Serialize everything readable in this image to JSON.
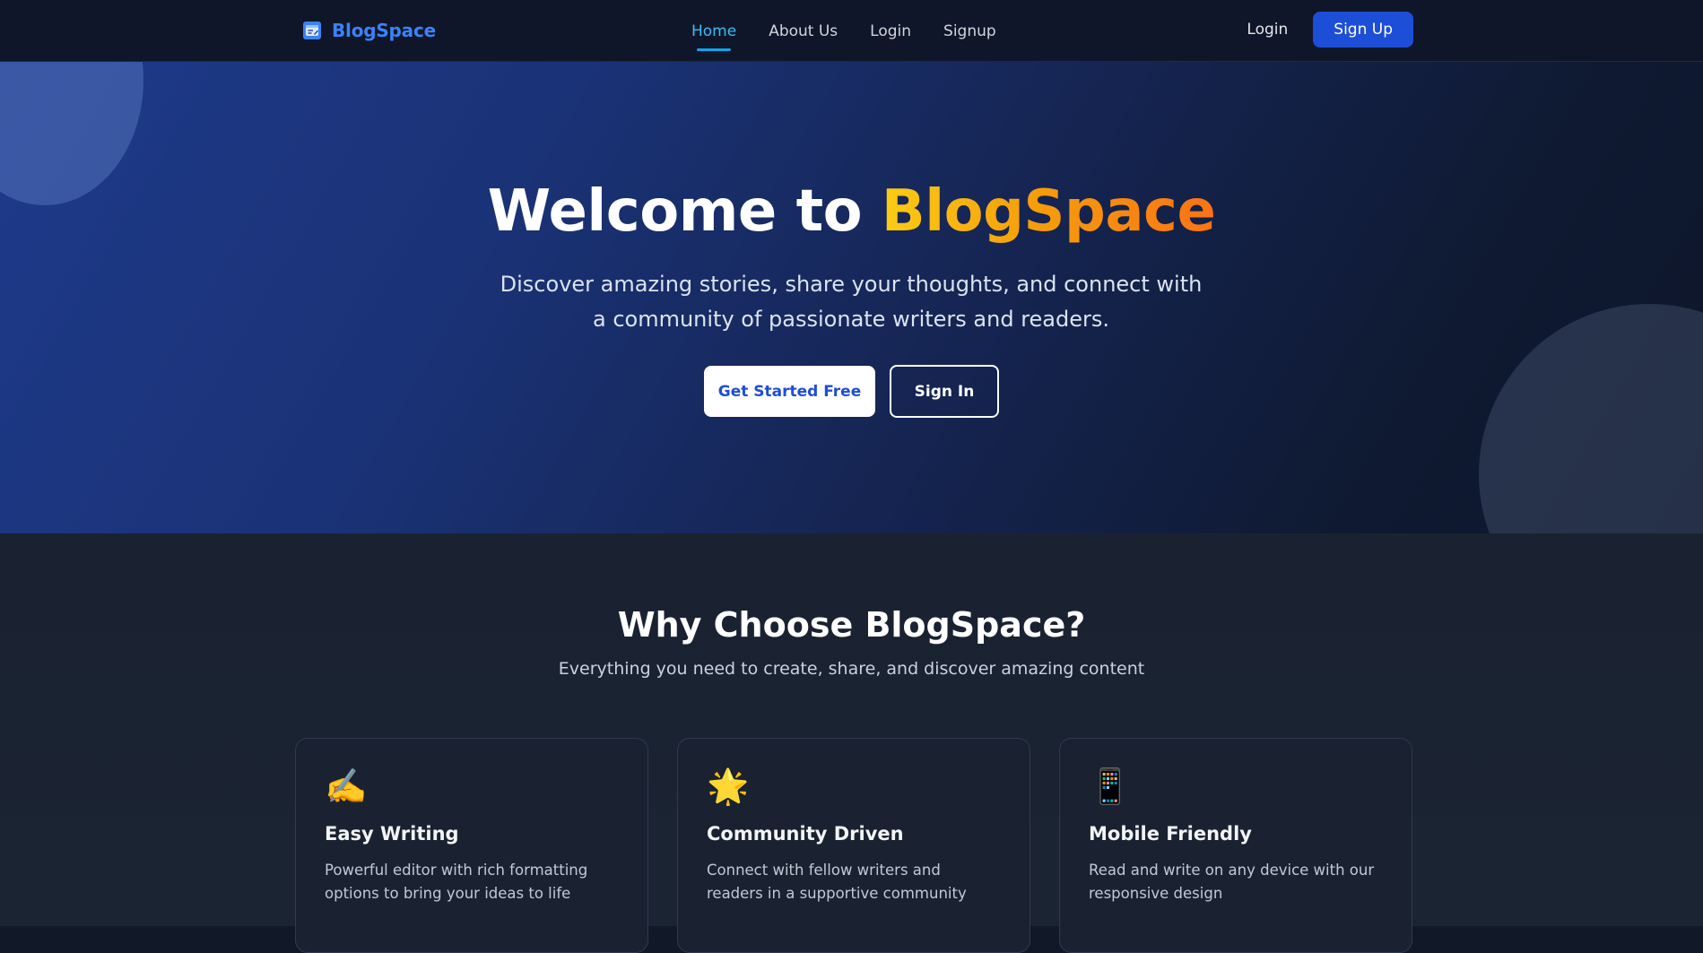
{
  "nav": {
    "brand": "BlogSpace",
    "links": [
      {
        "label": "Home",
        "active": true
      },
      {
        "label": "About Us",
        "active": false
      },
      {
        "label": "Login",
        "active": false
      },
      {
        "label": "Signup",
        "active": false
      }
    ],
    "login_label": "Login",
    "signup_label": "Sign Up"
  },
  "hero": {
    "title_prefix": "Welcome to ",
    "title_accent": "BlogSpace",
    "subtitle": "Discover amazing stories, share your thoughts, and connect with a community of passionate writers and readers.",
    "primary_cta": "Get Started Free",
    "secondary_cta": "Sign In"
  },
  "features": {
    "title": "Why Choose BlogSpace?",
    "subtitle": "Everything you need to create, share, and discover amazing content",
    "cards": [
      {
        "icon": "✍️",
        "icon_name": "writing-hand-icon",
        "title": "Easy Writing",
        "description": "Powerful editor with rich formatting options to bring your ideas to life"
      },
      {
        "icon": "🌟",
        "icon_name": "star-icon",
        "title": "Community Driven",
        "description": "Connect with fellow writers and readers in a supportive community"
      },
      {
        "icon": "📱",
        "icon_name": "mobile-phone-icon",
        "title": "Mobile Friendly",
        "description": "Read and write on any device with our responsive design"
      }
    ]
  },
  "colors": {
    "brand_blue": "#3b82f6",
    "active_link": "#38bdf8",
    "signup_button": "#1d4ed8",
    "accent_gradient_start": "#facc15",
    "accent_gradient_end": "#f97316",
    "page_background": "#111827"
  }
}
